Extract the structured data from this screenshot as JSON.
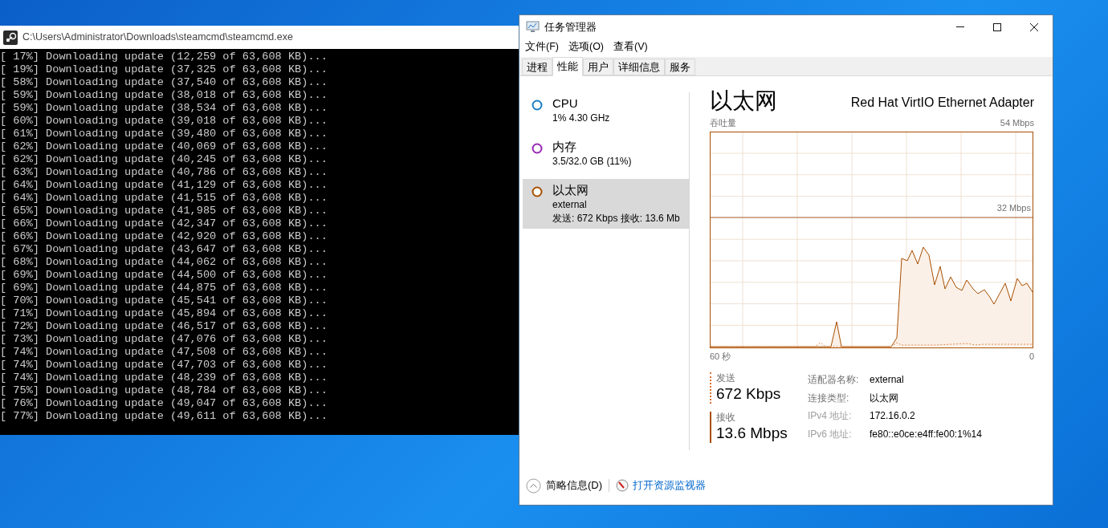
{
  "console": {
    "title": "C:\\Users\\Administrator\\Downloads\\steamcmd\\steamcmd.exe",
    "lines": [
      "[ 17%] Downloading update (12,259 of 63,608 KB)...",
      "[ 19%] Downloading update (37,325 of 63,608 KB)...",
      "[ 58%] Downloading update (37,540 of 63,608 KB)...",
      "[ 59%] Downloading update (38,018 of 63,608 KB)...",
      "[ 59%] Downloading update (38,534 of 63,608 KB)...",
      "[ 60%] Downloading update (39,018 of 63,608 KB)...",
      "[ 61%] Downloading update (39,480 of 63,608 KB)...",
      "[ 62%] Downloading update (40,069 of 63,608 KB)...",
      "[ 62%] Downloading update (40,245 of 63,608 KB)...",
      "[ 63%] Downloading update (40,786 of 63,608 KB)...",
      "[ 64%] Downloading update (41,129 of 63,608 KB)...",
      "[ 64%] Downloading update (41,515 of 63,608 KB)...",
      "[ 65%] Downloading update (41,985 of 63,608 KB)...",
      "[ 66%] Downloading update (42,347 of 63,608 KB)...",
      "[ 66%] Downloading update (42,920 of 63,608 KB)...",
      "[ 67%] Downloading update (43,647 of 63,608 KB)...",
      "[ 68%] Downloading update (44,062 of 63,608 KB)...",
      "[ 69%] Downloading update (44,500 of 63,608 KB)...",
      "[ 69%] Downloading update (44,875 of 63,608 KB)...",
      "[ 70%] Downloading update (45,541 of 63,608 KB)...",
      "[ 71%] Downloading update (45,894 of 63,608 KB)...",
      "[ 72%] Downloading update (46,517 of 63,608 KB)...",
      "[ 73%] Downloading update (47,076 of 63,608 KB)...",
      "[ 74%] Downloading update (47,508 of 63,608 KB)...",
      "[ 74%] Downloading update (47,703 of 63,608 KB)...",
      "[ 74%] Downloading update (48,239 of 63,608 KB)...",
      "[ 75%] Downloading update (48,784 of 63,608 KB)...",
      "[ 76%] Downloading update (49,047 of 63,608 KB)...",
      "[ 77%] Downloading update (49,611 of 63,608 KB)..."
    ]
  },
  "task_manager": {
    "title": "任务管理器",
    "menu": [
      "文件(F)",
      "选项(O)",
      "查看(V)"
    ],
    "tabs": [
      {
        "label": "进程",
        "selected": false
      },
      {
        "label": "性能",
        "selected": true
      },
      {
        "label": "用户",
        "selected": false
      },
      {
        "label": "详细信息",
        "selected": false
      },
      {
        "label": "服务",
        "selected": false
      }
    ],
    "sidebar": {
      "items": [
        {
          "name": "CPU",
          "lines": [
            "1% 4.30 GHz"
          ],
          "color": "#1a7fc4",
          "selected": false
        },
        {
          "name": "内存",
          "lines": [
            "3.5/32.0 GB (11%)"
          ],
          "color": "#9528b4",
          "selected": false
        },
        {
          "name": "以太网",
          "lines": [
            "external",
            "发送: 672 Kbps 接收: 13.6 Mb"
          ],
          "color": "#a74f01",
          "selected": true
        }
      ]
    },
    "detail": {
      "title": "以太网",
      "adapter": "Red Hat VirtIO Ethernet Adapter",
      "chart_label": "吞吐量",
      "chart_max": "54 Mbps",
      "chart_mid": "32 Mbps",
      "time_span": "60 秒",
      "time_end": "0",
      "stats": [
        {
          "kind": "send",
          "label": "发送",
          "value": "672 Kbps"
        },
        {
          "kind": "receive",
          "label": "接收",
          "value": "13.6 Mbps"
        }
      ],
      "properties": [
        {
          "label": "适配器名称:",
          "value": "external"
        },
        {
          "label": "连接类型:",
          "value": "以太网"
        },
        {
          "label": "IPv4 地址:",
          "value": "172.16.0.2"
        },
        {
          "label": "IPv6 地址:",
          "value": "fe80::e0ce:e4ff:fe00:1%14"
        }
      ]
    },
    "footer": {
      "summary": "简略信息(D)",
      "monitor_link": "打开资源监视器"
    }
  }
}
